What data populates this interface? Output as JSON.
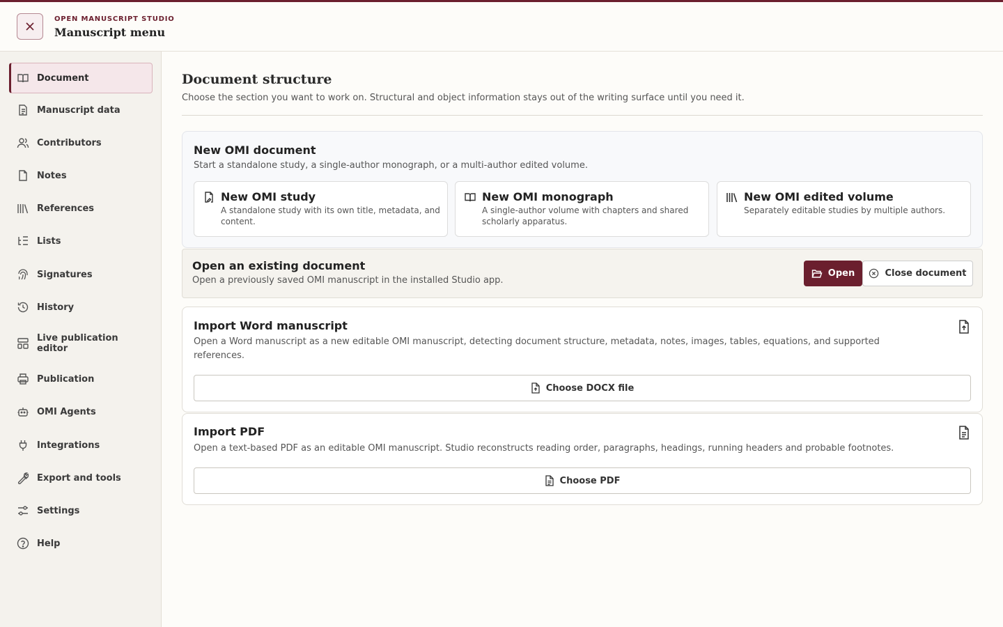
{
  "app": {
    "kicker": "OPEN MANUSCRIPT STUDIO",
    "title": "Manuscript menu"
  },
  "sidebar": {
    "items": [
      {
        "label": "Document",
        "icon": "book-open-icon",
        "active": true
      },
      {
        "label": "Manuscript data",
        "icon": "file-text-icon"
      },
      {
        "label": "Contributors",
        "icon": "users-icon"
      },
      {
        "label": "Notes",
        "icon": "note-icon"
      },
      {
        "label": "References",
        "icon": "library-icon"
      },
      {
        "label": "Lists",
        "icon": "list-tree-icon"
      },
      {
        "label": "Signatures",
        "icon": "fingerprint-icon"
      },
      {
        "label": "History",
        "icon": "history-icon"
      },
      {
        "label": "Live publication editor",
        "icon": "layout-icon"
      },
      {
        "label": "Publication",
        "icon": "printer-icon"
      },
      {
        "label": "OMI Agents",
        "icon": "bot-icon"
      },
      {
        "label": "Integrations",
        "icon": "plug-icon"
      },
      {
        "label": "Export and tools",
        "icon": "wrench-icon"
      },
      {
        "label": "Settings",
        "icon": "sliders-icon"
      },
      {
        "label": "Help",
        "icon": "help-circle-icon"
      }
    ]
  },
  "main": {
    "title": "Document structure",
    "subtitle": "Choose the section you want to work on. Structural and object information stays out of the writing surface until you need it.",
    "new_doc": {
      "title": "New OMI document",
      "desc": "Start a standalone study, a single-author monograph, or a multi-author edited volume.",
      "options": [
        {
          "title": "New OMI study",
          "desc": "A standalone study with its own title, metadata, and content.",
          "icon": "file-signature-icon"
        },
        {
          "title": "New OMI monograph",
          "desc": "A single-author volume with chapters and shared scholarly apparatus.",
          "icon": "book-open-icon"
        },
        {
          "title": "New OMI edited volume",
          "desc": "Separately editable studies by multiple authors.",
          "icon": "library-icon"
        }
      ]
    },
    "open_doc": {
      "title": "Open an existing document",
      "desc": "Open a previously saved OMI manuscript in the installed Studio app.",
      "open_label": "Open",
      "close_label": "Close document"
    },
    "import_word": {
      "title": "Import Word manuscript",
      "desc": "Open a Word manuscript as a new editable OMI manuscript, detecting document structure, metadata, notes, images, tables, equations, and supported references.",
      "button": "Choose DOCX file"
    },
    "import_pdf": {
      "title": "Import PDF",
      "desc": "Open a text-based PDF as an editable OMI manuscript. Studio reconstructs reading order, paragraphs, headings, running headers and probable footnotes.",
      "button": "Choose PDF"
    }
  },
  "colors": {
    "accent": "#6b1f2e",
    "sidebar_bg": "#f4f2ed",
    "page_bg": "#fdfcf9"
  }
}
